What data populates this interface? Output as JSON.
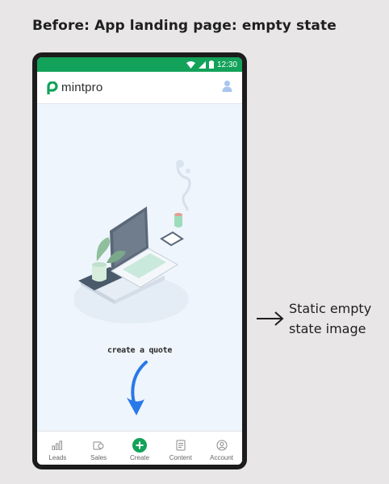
{
  "heading": "Before: App landing page: empty state",
  "status_bar": {
    "time": "12:30"
  },
  "app": {
    "logo_text": "mintpro",
    "brand_color": "#13a25a",
    "avatar_icon": "user-avatar-icon"
  },
  "empty_state": {
    "illustration": "laptop-desk-illustration",
    "cta_text": "create a quote",
    "arrow_color": "#2979e8"
  },
  "bottom_nav": {
    "items": [
      {
        "label": "Leads",
        "icon": "bar-chart-icon"
      },
      {
        "label": "Sales",
        "icon": "sales-icon"
      },
      {
        "label": "Create",
        "icon": "plus-circle-icon"
      },
      {
        "label": "Content",
        "icon": "document-icon"
      },
      {
        "label": "Account",
        "icon": "account-icon"
      }
    ]
  },
  "annotation": {
    "text": "Static empty state image"
  }
}
